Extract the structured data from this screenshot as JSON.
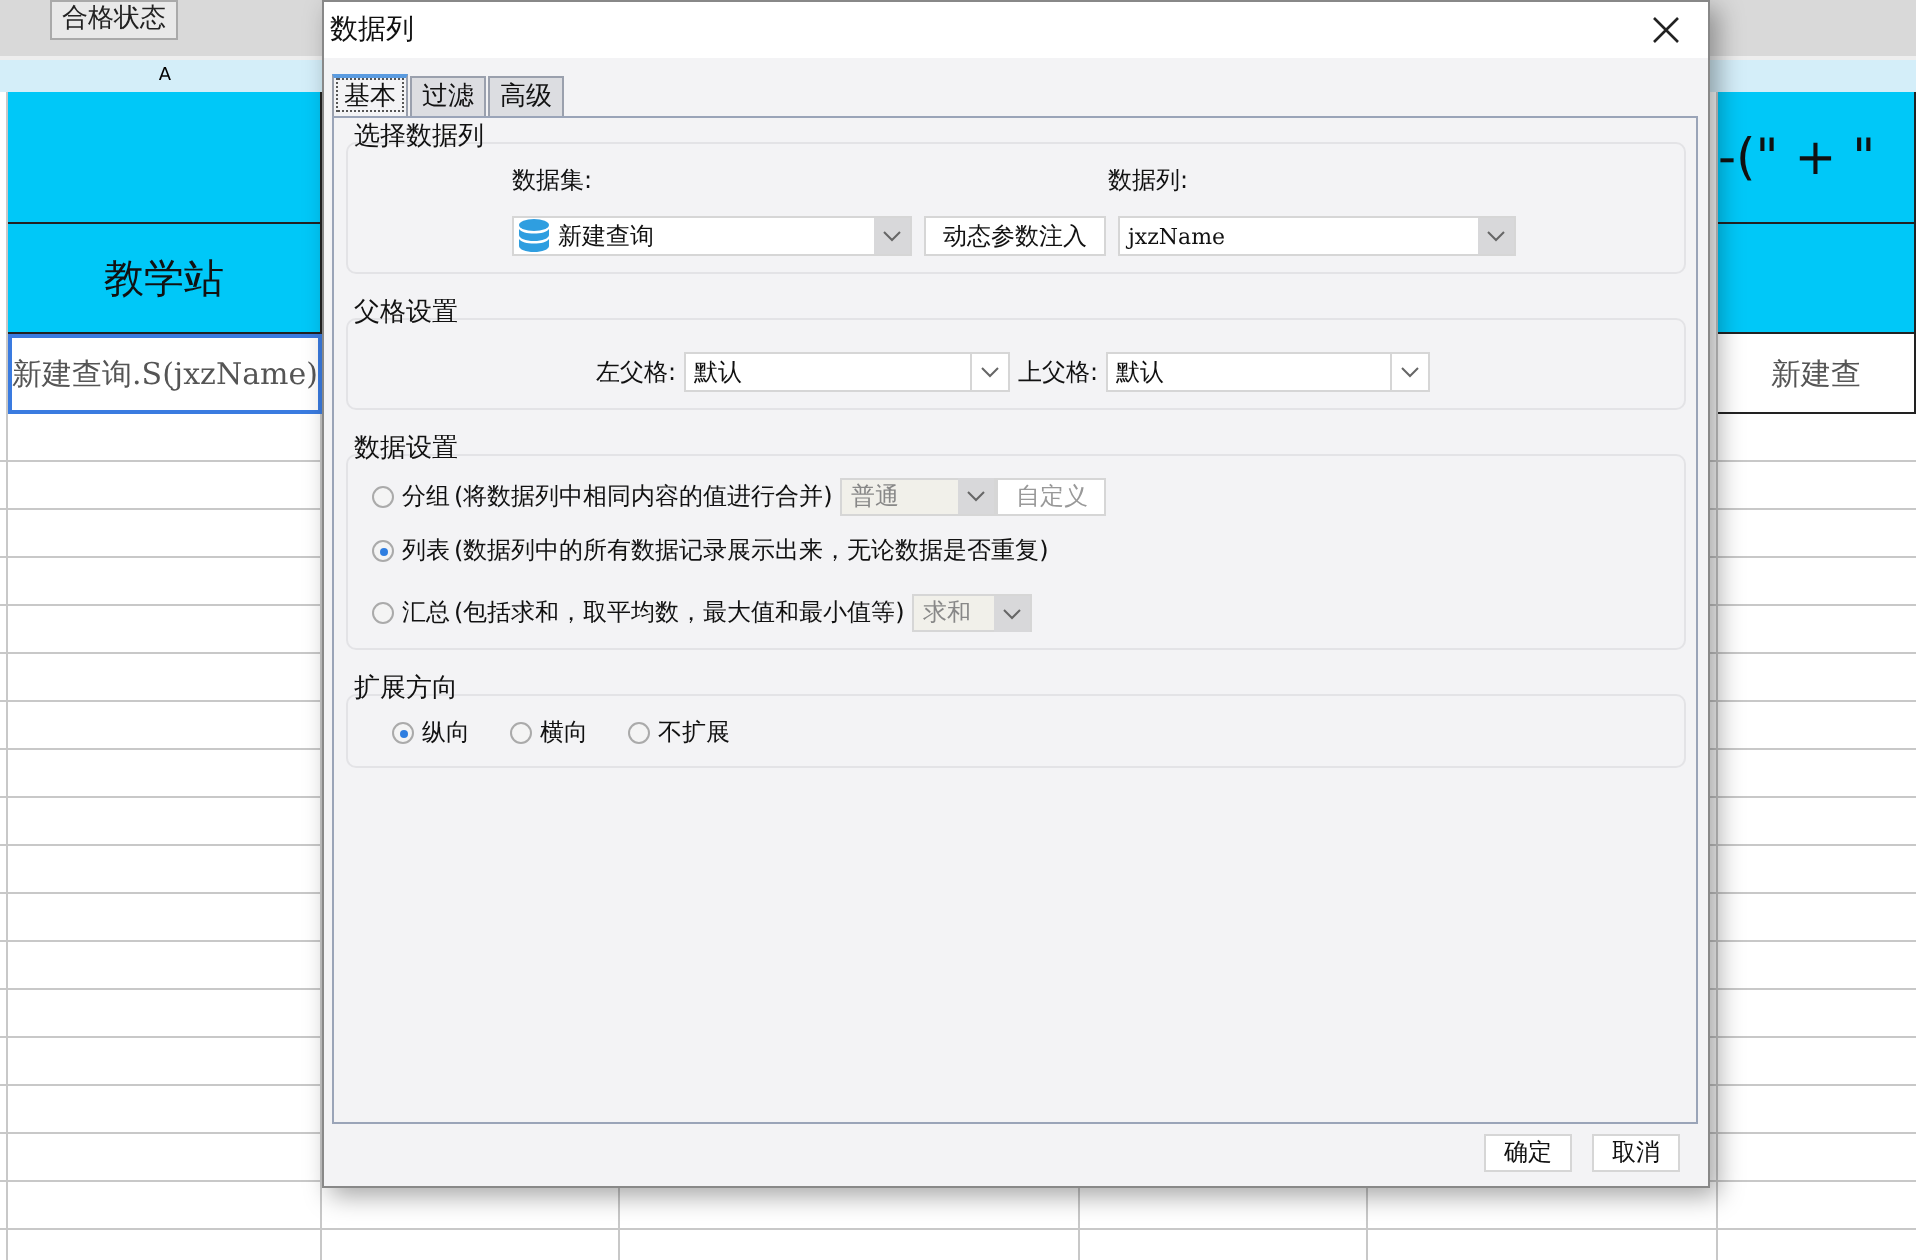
{
  "sheet": {
    "tab": "合格状态",
    "column_a_header": "A",
    "title_row": {
      "right_text": "-(\" + \""
    },
    "header_row": {
      "column_a": "教学站"
    },
    "data_row": {
      "column_a": "新建查询.S(jxzName)",
      "column_a_selected": true,
      "right_text": "新建查"
    }
  },
  "dialog": {
    "title": "数据列",
    "tabs": [
      {
        "label": "基本",
        "selected": true
      },
      {
        "label": "过滤",
        "selected": false
      },
      {
        "label": "高级",
        "selected": false
      }
    ],
    "select_column": {
      "legend": "选择数据列",
      "dataset_label": "数据集:",
      "dataset_value": "新建查询",
      "inject_button": "动态参数注入",
      "column_label": "数据列:",
      "column_value": "jxzName"
    },
    "parent": {
      "legend": "父格设置",
      "left_label": "左父格:",
      "left_value": "默认",
      "top_label": "上父格:",
      "top_value": "默认"
    },
    "data_settings": {
      "legend": "数据设置",
      "options": [
        {
          "kind": "group",
          "label": "分组",
          "note": "(将数据列中相同内容的值进行合并)",
          "selected": false,
          "combo": {
            "value": "普通",
            "disabled": true
          },
          "button": {
            "label": "自定义",
            "disabled": true
          }
        },
        {
          "kind": "list",
          "label": "列表",
          "note": "(数据列中的所有数据记录展示出来，无论数据是否重复)",
          "selected": true
        },
        {
          "kind": "summary",
          "label": "汇总",
          "note": "(包括求和，取平均数，最大值和最小值等)",
          "selected": false,
          "combo": {
            "value": "求和",
            "disabled": true
          }
        }
      ]
    },
    "expand": {
      "legend": "扩展方向",
      "options": [
        {
          "label": "纵向",
          "selected": true
        },
        {
          "label": "横向",
          "selected": false
        },
        {
          "label": "不扩展",
          "selected": false
        }
      ]
    },
    "buttons": [
      "确定",
      "取消"
    ]
  }
}
